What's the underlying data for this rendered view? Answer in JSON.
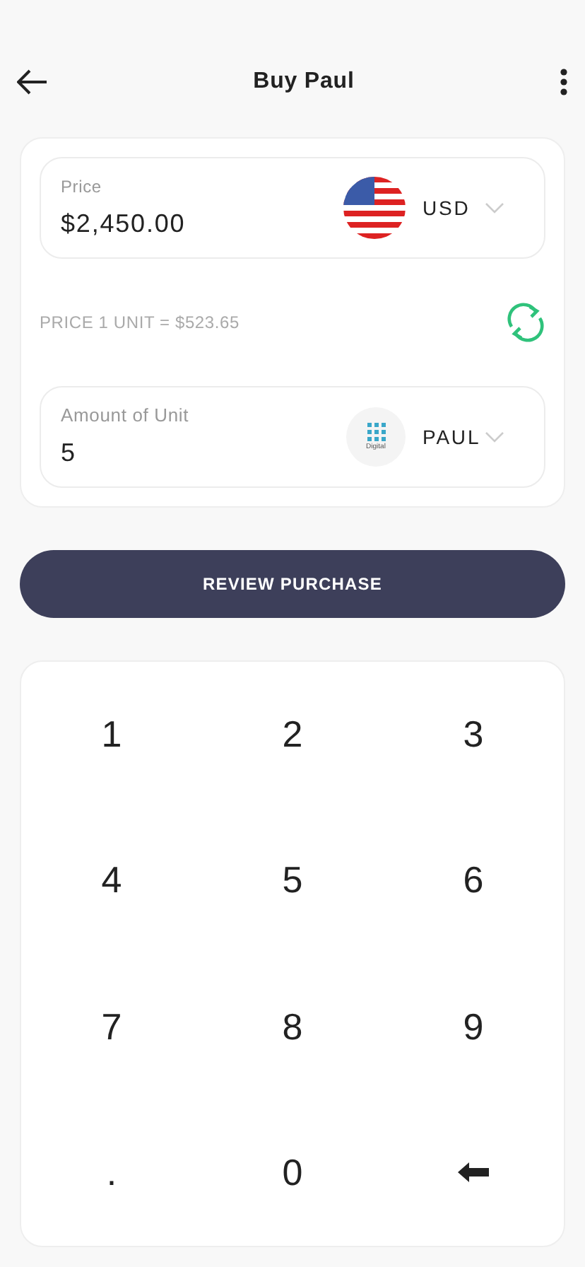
{
  "header": {
    "title": "Buy Paul"
  },
  "price_field": {
    "label": "Price",
    "value": "$2,450.00",
    "currency": "USD"
  },
  "rate": {
    "text": "PRICE 1 UNIT = $523.65"
  },
  "amount_field": {
    "label": "Amount of Unit",
    "value": "5",
    "currency": "PAUL",
    "logo_text": "Digital"
  },
  "review_button": {
    "label": "REVIEW PURCHASE"
  },
  "keypad": [
    {
      "kind": "digit",
      "label": "1"
    },
    {
      "kind": "digit",
      "label": "2"
    },
    {
      "kind": "digit",
      "label": "3"
    },
    {
      "kind": "digit",
      "label": "4"
    },
    {
      "kind": "digit",
      "label": "5"
    },
    {
      "kind": "digit",
      "label": "6"
    },
    {
      "kind": "digit",
      "label": "7"
    },
    {
      "kind": "digit",
      "label": "8"
    },
    {
      "kind": "digit",
      "label": "9"
    },
    {
      "kind": "digit",
      "label": "."
    },
    {
      "kind": "digit",
      "label": "0"
    },
    {
      "kind": "backspace"
    }
  ]
}
